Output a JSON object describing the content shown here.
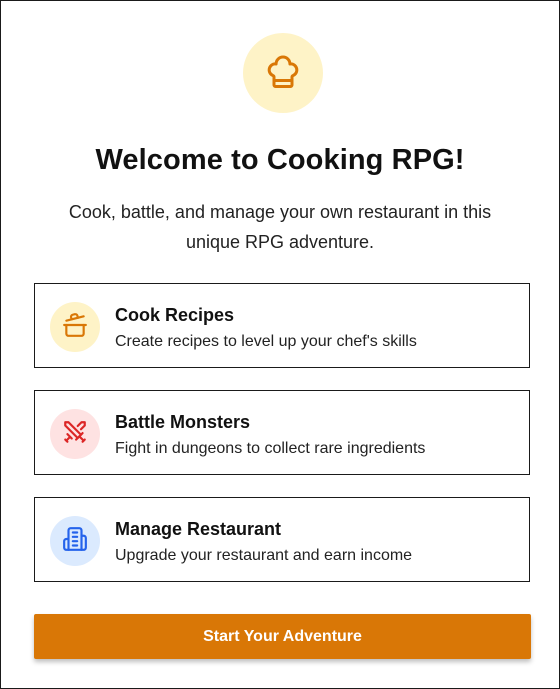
{
  "colors": {
    "primary": "#D97706",
    "logo_bg": "#FEF3C7",
    "cook_bg": "#FEF3C7",
    "cook_icon": "#D97706",
    "battle_bg": "#FEE2E2",
    "battle_icon": "#DC2626",
    "manage_bg": "#DBEAFE",
    "manage_icon": "#2563EB"
  },
  "header": {
    "icon": "chef-hat-icon",
    "title": "Welcome to Cooking RPG!",
    "subtitle": "Cook, battle, and manage your own restaurant in this unique RPG adventure."
  },
  "features": [
    {
      "icon": "cooking-pot-icon",
      "title": "Cook Recipes",
      "description": "Create recipes to level up your chef's skills"
    },
    {
      "icon": "crossed-swords-icon",
      "title": "Battle Monsters",
      "description": "Fight in dungeons to collect rare ingredients"
    },
    {
      "icon": "building-icon",
      "title": "Manage Restaurant",
      "description": "Upgrade your restaurant and earn income"
    }
  ],
  "start_button": {
    "label": "Start Your Adventure"
  }
}
